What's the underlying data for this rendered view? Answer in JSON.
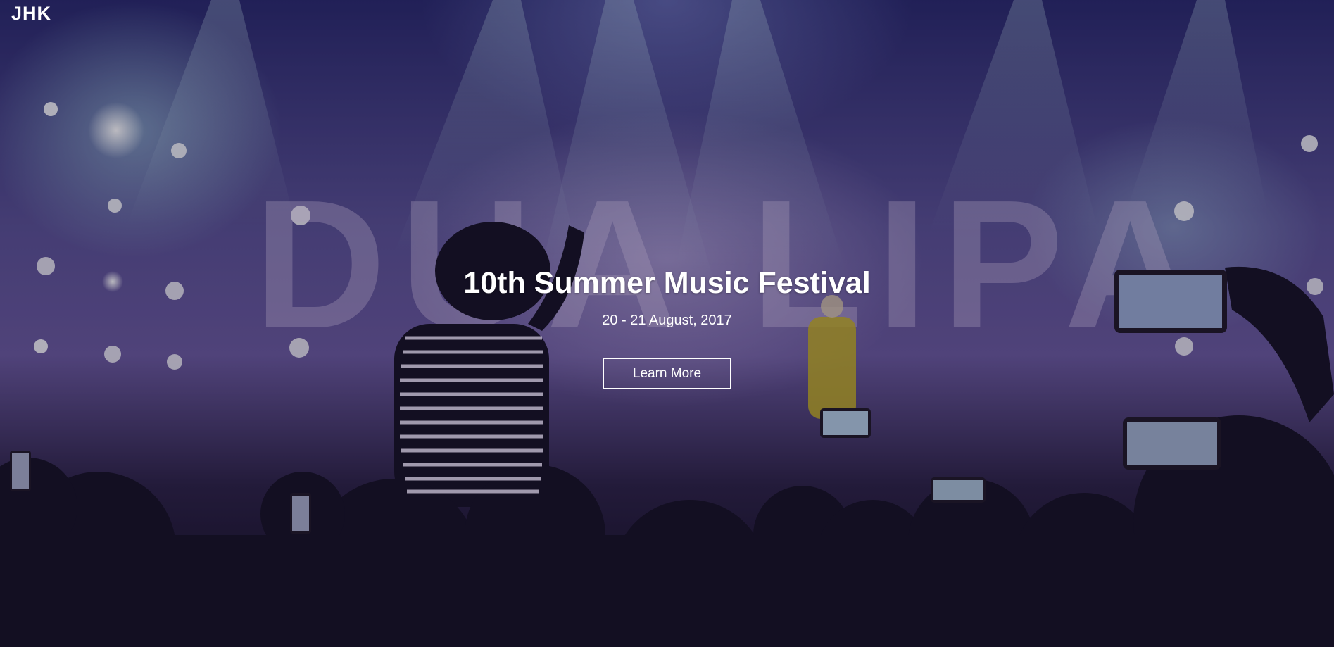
{
  "header": {
    "logo": "JHK"
  },
  "hero": {
    "title": "10th Summer Music Festival",
    "date": "20 - 21 August, 2017",
    "cta_label": "Learn More"
  },
  "background": {
    "stage_sign_text": "DUA LIPA"
  },
  "colors": {
    "text": "#ffffff",
    "stage_sky": "#5b5295",
    "crowd": "#0e0b1c"
  }
}
